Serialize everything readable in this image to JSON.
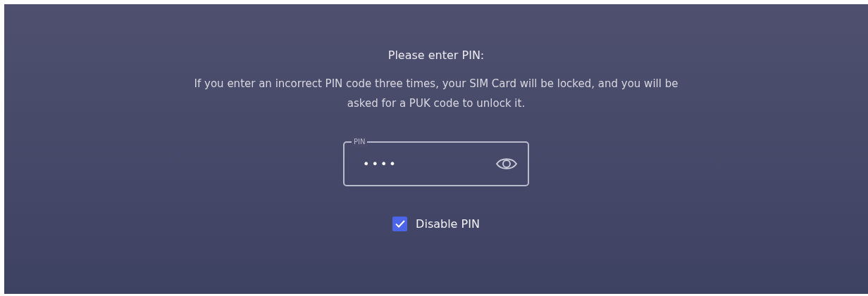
{
  "title": "Please enter PIN:",
  "message": "If you enter an incorrect PIN code three times, your SIM Card will be locked, and you will be asked for a PUK code to unlock it.",
  "pin_field": {
    "label": "PIN",
    "value": "••••"
  },
  "disable_pin": {
    "label": "Disable PIN",
    "checked": true
  }
}
